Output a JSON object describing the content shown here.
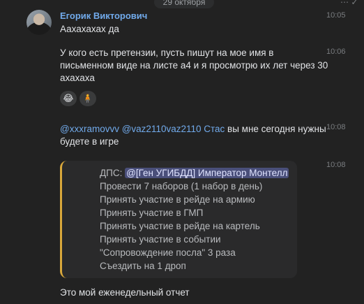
{
  "date_label": "29 октября",
  "corner_icons": "⋯ ✓",
  "author": "Егорик Викторович",
  "messages": [
    {
      "time": "10:05",
      "text": "Аахахахах да"
    },
    {
      "time": "10:06",
      "line1": "У кого есть претензии, пусть пишут на мое имя в",
      "line2": "письменном виде на листе а4 и я просмотрю их лет через 30",
      "line3": "ахахаха"
    },
    {
      "time": "10:08",
      "mentions": "@xxxramovvv @vaz2110vaz2110 Стас",
      "tail": " вы мне сегодня нужны",
      "line2": "будете в игре"
    },
    {
      "time": "10:08"
    }
  ],
  "reactions": [
    "😂",
    "🧍"
  ],
  "quote": {
    "prefix": "ДПС: ",
    "mention": "@[Ген УГИБДД] Император Монтелл",
    "lines": [
      "Провести 7 наборов (1 набор в день)",
      "Принять участие в рейде на армию",
      "Принять участие в ГМП",
      "Принять участие в рейде на картель",
      "Принять участие в событии",
      "\"Сопровождение посла\" 3 раза",
      "Съездить на 1 дроп"
    ]
  },
  "footer_text": "Это мой еженедельный отчет"
}
